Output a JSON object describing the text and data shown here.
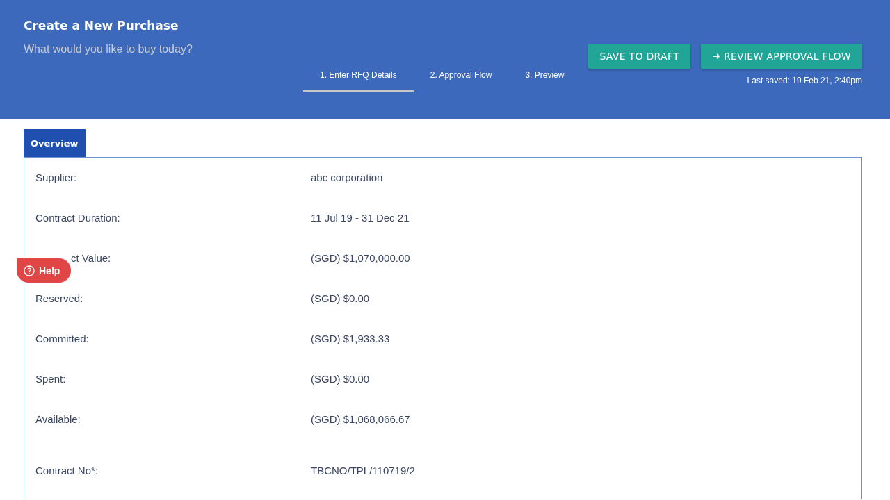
{
  "header": {
    "title": "Create a New Purchase",
    "subtitle": "What would you like to buy today?",
    "buttons": [
      {
        "label": "SAVE TO DRAFT",
        "kind": "plain"
      },
      {
        "label": "REVIEW APPROVAL FLOW",
        "kind": "forward"
      }
    ],
    "steps": [
      {
        "label": "1. Enter RFQ Details",
        "selected": true
      },
      {
        "label": "2. Approval Flow",
        "selected": false
      },
      {
        "label": "3. Preview",
        "selected": false
      }
    ],
    "last_saved": "Last saved: 19 Feb 21, 2:40pm"
  },
  "panel": {
    "tab": "Overview",
    "sections": [
      {
        "rows": [
          {
            "label": "Supplier:",
            "value": "abc corporation",
            "covered": false
          },
          {
            "label": "Contract Duration:",
            "value": "11 Jul 19 - 31 Dec 21",
            "covered": false
          },
          {
            "label": "ct Value:",
            "value": "(SGD) $1,070,000.00",
            "covered": true
          },
          {
            "label": "Reserved:",
            "value": "(SGD) $0.00",
            "covered": false
          },
          {
            "label": "Committed:",
            "value": "(SGD) $1,933.33",
            "covered": false
          },
          {
            "label": "Spent:",
            "value": "(SGD) $0.00",
            "covered": false
          },
          {
            "label": "Available:",
            "value": "(SGD) $1,068,066.67",
            "covered": false
          }
        ]
      },
      {
        "rows": [
          {
            "label": "Contract No*:",
            "value": "TBCNO/TPL/110719/2",
            "covered": false
          }
        ]
      }
    ]
  },
  "help_button": {
    "label": "Help"
  }
}
